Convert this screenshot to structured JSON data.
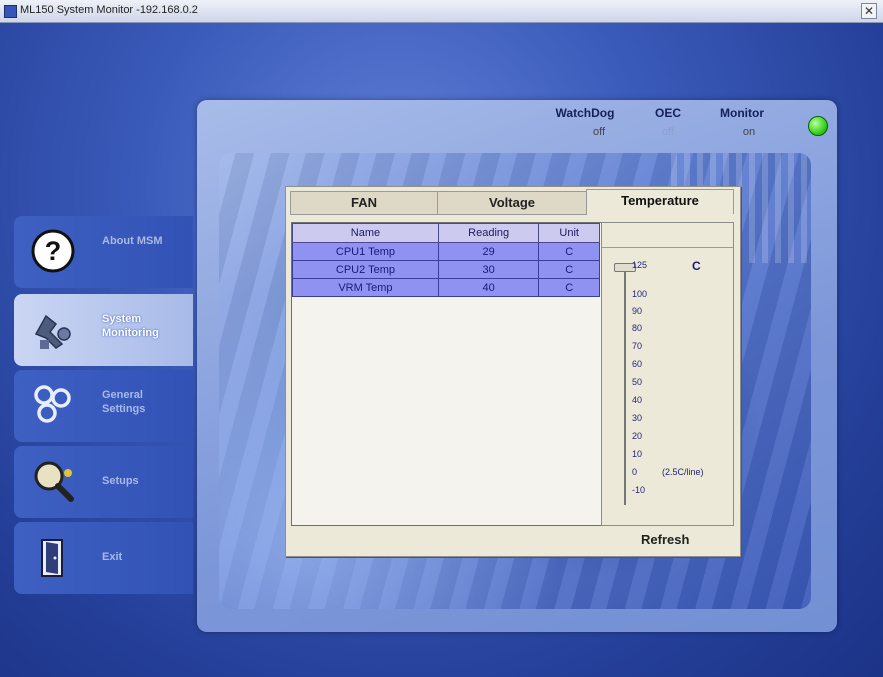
{
  "window": {
    "title": "ML150 System Monitor -192.168.0.2",
    "close_glyph": "✕"
  },
  "status": {
    "watchdog": {
      "label": "WatchDog",
      "value": "off"
    },
    "oec": {
      "label": "OEC",
      "value": "off"
    },
    "monitor": {
      "label": "Monitor",
      "value": "on"
    },
    "indicator_color": "#37d21b"
  },
  "sidebar": {
    "items": [
      {
        "label": "About MSM",
        "icon": "help-icon"
      },
      {
        "label": "System Monitoring",
        "icon": "system-monitoring-icon",
        "active": true
      },
      {
        "label": "General Settings",
        "icon": "settings-icon"
      },
      {
        "label": "Setups",
        "icon": "search-icon"
      },
      {
        "label": "Exit",
        "icon": "exit-door-icon"
      }
    ]
  },
  "tabs": [
    {
      "label": "FAN"
    },
    {
      "label": "Voltage"
    },
    {
      "label": "Temperature",
      "active": true
    }
  ],
  "table": {
    "columns": [
      "Name",
      "Reading",
      "Unit"
    ],
    "rows": [
      {
        "name": "CPU1 Temp",
        "reading": "29",
        "unit": "C"
      },
      {
        "name": "CPU2 Temp",
        "reading": "30",
        "unit": "C"
      },
      {
        "name": "VRM Temp",
        "reading": "40",
        "unit": "C"
      }
    ]
  },
  "scale": {
    "unit": "C",
    "ticks": [
      "125",
      "100",
      "90",
      "80",
      "70",
      "60",
      "50",
      "40",
      "30",
      "20",
      "10",
      "0",
      "-10"
    ],
    "note": "(2.5C/line)"
  },
  "refresh_label": "Refresh"
}
